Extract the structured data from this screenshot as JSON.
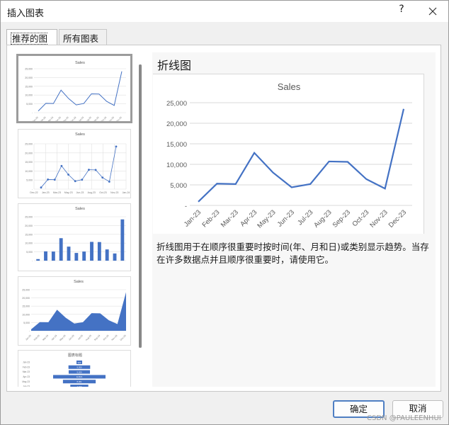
{
  "window": {
    "title": "插入图表",
    "help_label": "?"
  },
  "tabs": [
    {
      "label": "推荐的图表",
      "active": true
    },
    {
      "label": "所有图表",
      "active": false
    }
  ],
  "preview": {
    "title": "折线图",
    "description": "折线图用于在顺序很重要时按时间(年、月和日)或类别显示趋势。当存在许多数据点并且顺序很重要时，请使用它。"
  },
  "buttons": {
    "ok": "确定",
    "cancel": "取消"
  },
  "watermark": "CSDN @PAULEENHUI",
  "colors": {
    "series": "#4472c4",
    "selected_border": "#9c9c9c",
    "ok_border": "#4f7fc3"
  },
  "chart_data": [
    {
      "type": "line",
      "title": "Sales",
      "categories": [
        "Jan-23",
        "Feb-23",
        "Mar-23",
        "Apr-23",
        "May-23",
        "Jun-23",
        "Jul-23",
        "Aug-23",
        "Sep-23",
        "Oct-23",
        "Nov-23",
        "Dec-23"
      ],
      "values": [
        900,
        5300,
        5200,
        12800,
        8000,
        4400,
        5200,
        10700,
        10600,
        6400,
        4100,
        23500
      ],
      "yticks": [
        "-",
        "5,000",
        "10,000",
        "15,000",
        "20,000",
        "25,000"
      ],
      "ylim": [
        0,
        25000
      ],
      "grid": true
    },
    {
      "type": "scatter",
      "title": "Sales",
      "xticks": [
        "Dec-22",
        "Jan-23",
        "Mar-23",
        "May-23",
        "Jun-23",
        "Aug-23",
        "Oct-23",
        "Nov-23",
        "Jan-24"
      ],
      "yticks": [
        "-",
        "5,000",
        "10,000",
        "15,000",
        "20,000",
        "25,000"
      ]
    },
    {
      "type": "bar",
      "title": "Sales",
      "yticks": [
        "-",
        "5,000",
        "10,000",
        "15,000",
        "20,000",
        "25,000"
      ]
    },
    {
      "type": "area",
      "title": "Sales",
      "yticks": [
        "-",
        "5,000",
        "10,000",
        "15,000",
        "20,000",
        "25,000"
      ]
    },
    {
      "type": "funnel",
      "title": "图表标题",
      "categories": [
        "Jan-23",
        "Feb-23",
        "Mar-23",
        "Apr-23",
        "May-23",
        "Jun-23"
      ],
      "labels": [
        "900",
        "5,300",
        "5,200",
        "12,821",
        "8,001",
        "4,400"
      ]
    }
  ]
}
